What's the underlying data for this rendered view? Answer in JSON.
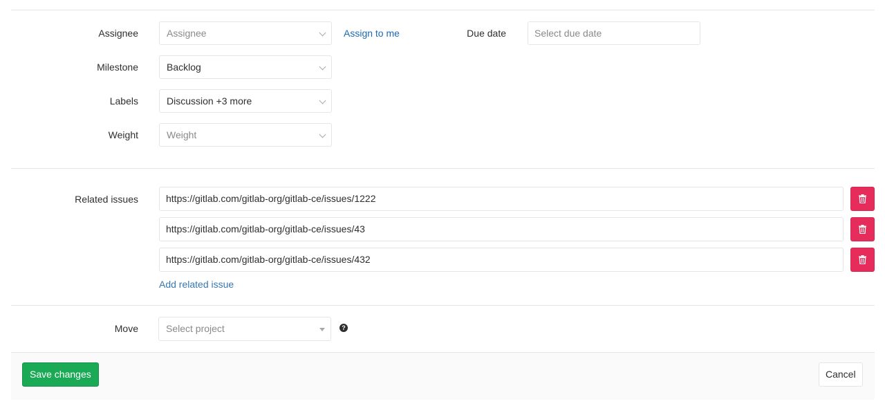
{
  "assignee": {
    "label": "Assignee",
    "placeholder": "Assignee",
    "assign_to_me": "Assign to me"
  },
  "due_date": {
    "label": "Due date",
    "placeholder": "Select due date"
  },
  "milestone": {
    "label": "Milestone",
    "value": "Backlog"
  },
  "labels": {
    "label": "Labels",
    "value": "Discussion +3 more"
  },
  "weight": {
    "label": "Weight",
    "placeholder": "Weight"
  },
  "related_issues": {
    "label": "Related issues",
    "items": [
      "https://gitlab.com/gitlab-org/gitlab-ce/issues/1222",
      "https://gitlab.com/gitlab-org/gitlab-ce/issues/43",
      "https://gitlab.com/gitlab-org/gitlab-ce/issues/432"
    ],
    "add_link": "Add related issue",
    "delete_icon": "trash-icon",
    "delete_color": "#e52c5a"
  },
  "move": {
    "label": "Move",
    "placeholder": "Select project",
    "help_icon": "question-circle-icon",
    "help_glyph": "?"
  },
  "footer": {
    "save_label": "Save changes",
    "cancel_label": "Cancel",
    "save_color": "#1aaa55"
  }
}
